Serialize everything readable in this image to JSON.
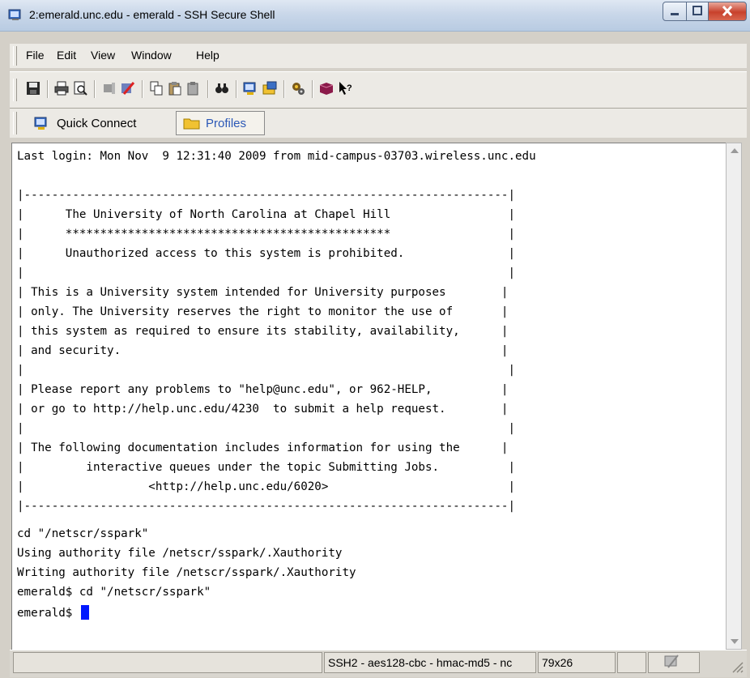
{
  "window": {
    "title": "2:emerald.unc.edu - emerald - SSH Secure Shell"
  },
  "menu": [
    "File",
    "Edit",
    "View",
    "Window",
    "Help"
  ],
  "toolbar_icons": [
    "save-icon",
    "print-icon",
    "print-preview-icon",
    "disconnect-icon",
    "settings-icon",
    "copy-icon",
    "paste-icon",
    "paste-special-icon",
    "find-icon",
    "new-terminal-icon",
    "new-file-transfer-icon",
    "gear-icon",
    "help-icon",
    "whats-this-icon"
  ],
  "quickbar": {
    "quick_connect": "Quick Connect",
    "profiles": "Profiles"
  },
  "terminal": {
    "lines": [
      "Last login: Mon Nov  9 12:31:40 2009 from mid-campus-03703.wireless.unc.edu",
      "",
      "|----------------------------------------------------------------------|",
      "|      The University of North Carolina at Chapel Hill                 |",
      "|      ***********************************************                 |",
      "|      Unauthorized access to this system is prohibited.               |",
      "|                                                                      |",
      "| This is a University system intended for University purposes        |",
      "| only. The University reserves the right to monitor the use of       |",
      "| this system as required to ensure its stability, availability,      |",
      "| and security.                                                       |",
      "|                                                                      |",
      "| Please report any problems to \"help@unc.edu\", or 962-HELP,          |",
      "| or go to http://help.unc.edu/4230  to submit a help request.        |",
      "|                                                                      |",
      "| The following documentation includes information for using the      |",
      "|         interactive queues under the topic Submitting Jobs.          |",
      "|                  <http://help.unc.edu/6020>                          |",
      "|----------------------------------------------------------------------|",
      "",
      "cd \"/netscr/sspark\"",
      "Using authority file /netscr/sspark/.Xauthority",
      "Writing authority file /netscr/sspark/.Xauthority",
      "emerald$ cd \"/netscr/sspark\"",
      "emerald$ "
    ]
  },
  "status": {
    "connection": "SSH2 - aes128-cbc - hmac-md5 - nc",
    "size": "79x26"
  },
  "colors": {
    "cursor": "#0018ff",
    "profiles_text": "#2b58b6",
    "close_button": "#c8412c"
  }
}
